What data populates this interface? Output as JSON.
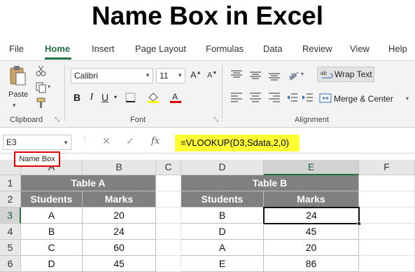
{
  "title": "Name Box in Excel",
  "ribbon_tabs": [
    "File",
    "Home",
    "Insert",
    "Page Layout",
    "Formulas",
    "Data",
    "Review",
    "View",
    "Help"
  ],
  "active_tab": "Home",
  "clipboard": {
    "paste_label": "Paste",
    "group_label": "Clipboard"
  },
  "font": {
    "family": "Calibri",
    "size": "11",
    "group_label": "Font",
    "bold": "B",
    "italic": "I",
    "underline": "U"
  },
  "alignment": {
    "wrap_text": "Wrap Text",
    "merge_center": "Merge & Center",
    "group_label": "Alignment"
  },
  "formula_bar": {
    "cell_ref": "E3",
    "formula": "=VLOOKUP(D3,Sdata,2,0)",
    "fx": "fx",
    "cancel": "✕",
    "enter": "✓"
  },
  "name_box_callout": "Name Box",
  "columns": [
    "A",
    "B",
    "C",
    "D",
    "E",
    "F"
  ],
  "rows": [
    "1",
    "2",
    "3",
    "4",
    "5",
    "6"
  ],
  "table_a": {
    "title": "Table A",
    "headers": [
      "Students",
      "Marks"
    ],
    "rows": [
      [
        "A",
        "20"
      ],
      [
        "B",
        "24"
      ],
      [
        "C",
        "60"
      ],
      [
        "D",
        "45"
      ]
    ]
  },
  "table_b": {
    "title": "Table B",
    "headers": [
      "Students",
      "Marks"
    ],
    "rows": [
      [
        "B",
        "24"
      ],
      [
        "D",
        "45"
      ],
      [
        "A",
        "20"
      ],
      [
        "E",
        "86"
      ]
    ]
  },
  "colors": {
    "excel_green": "#217346",
    "header_gray": "#808080",
    "formula_highlight": "#ffff33",
    "callout_red": "#e00000"
  }
}
